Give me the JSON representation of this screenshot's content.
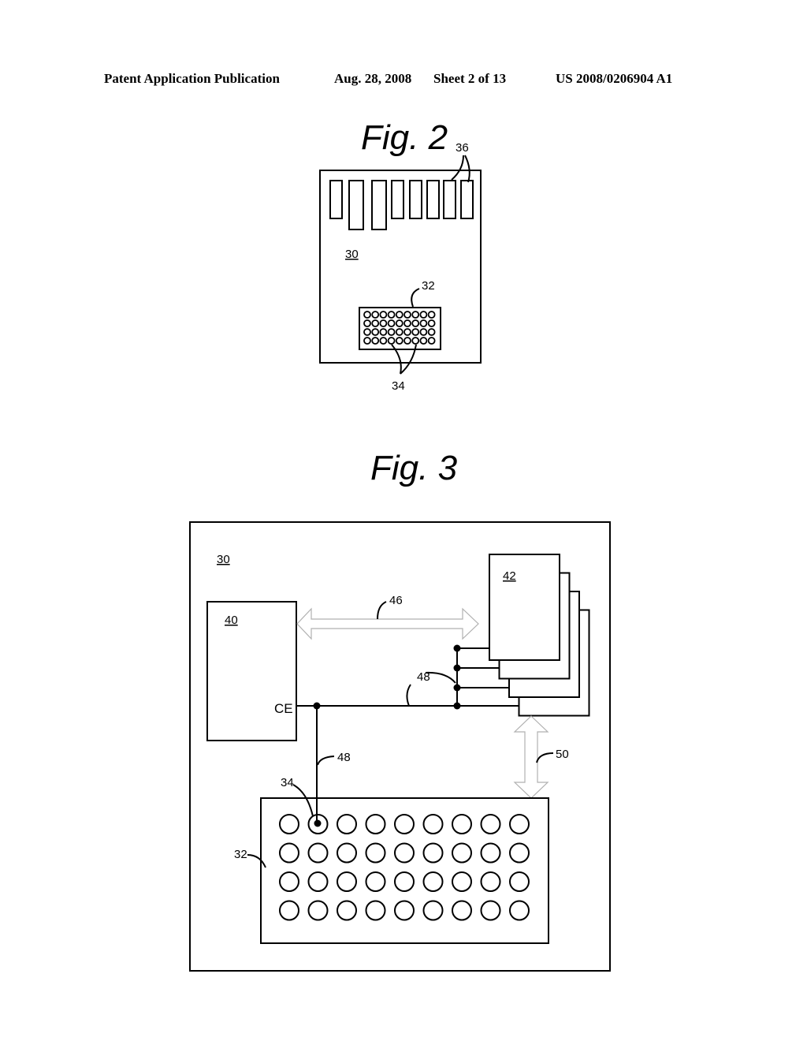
{
  "header": {
    "publication": "Patent Application Publication",
    "date": "Aug. 28, 2008",
    "sheet": "Sheet 2 of 13",
    "number": "US 2008/0206904 A1"
  },
  "fig2": {
    "title": "Fig. 2",
    "labels": {
      "card": "30",
      "contacts": "36",
      "pad_array": "32",
      "pads": "34"
    },
    "contacts_count": 8,
    "pad_rows": 4,
    "pad_cols": 9
  },
  "fig3": {
    "title": "Fig. 3",
    "labels": {
      "card": "30",
      "controller": "40",
      "memory": "42",
      "bus_46": "46",
      "line_48_top": "48",
      "line_48_bottom": "48",
      "bus_50": "50",
      "pad_array": "32",
      "pad": "34",
      "ce_pin": "CE"
    },
    "memory_chips": 4,
    "pad_rows": 4,
    "pad_cols": 9
  }
}
